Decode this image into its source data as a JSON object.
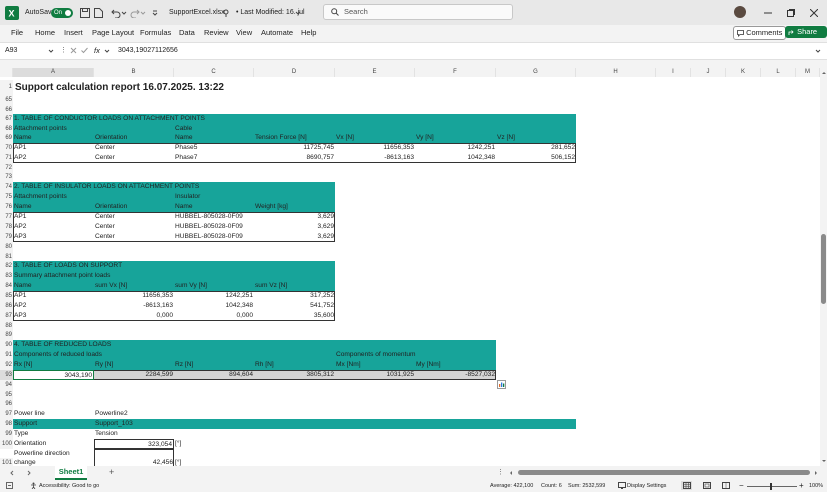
{
  "titlebar": {
    "autosave_label": "AutoSave",
    "autosave_state": "On",
    "filename": "SupportExcel.xlsx",
    "last_modified": "• Last Modified: 16. jul",
    "search_placeholder": "Search"
  },
  "menu": [
    "File",
    "Home",
    "Insert",
    "Page Layout",
    "Formulas",
    "Data",
    "Review",
    "View",
    "Automate",
    "Help"
  ],
  "menu_right": {
    "comments": "Comments",
    "share": "Share"
  },
  "formula": {
    "cell_ref": "A93",
    "fx": "fx",
    "value": "3043,190271126​56"
  },
  "columns": [
    "A",
    "B",
    "C",
    "D",
    "E",
    "F",
    "G",
    "H",
    "I",
    "J",
    "K",
    "L",
    "M"
  ],
  "rows": {
    "r1": "1",
    "r65": "65",
    "r66": "66",
    "r67": "67",
    "r68": "68",
    "r69": "69",
    "r70": "70",
    "r71": "71",
    "r72": "72",
    "r73": "73",
    "r74": "74",
    "r75": "75",
    "r76": "76",
    "r77": "77",
    "r78": "78",
    "r79": "79",
    "r80": "80",
    "r81": "81",
    "r82": "82",
    "r83": "83",
    "r84": "84",
    "r85": "85",
    "r86": "86",
    "r87": "87",
    "r88": "88",
    "r89": "89",
    "r90": "90",
    "r91": "91",
    "r92": "92",
    "r93": "93",
    "r94": "94",
    "r95": "95",
    "r96": "96",
    "r97": "97",
    "r98": "98",
    "r99": "99",
    "r100": "100",
    "r101": "101"
  },
  "report_title": "Support calculation report 16.07.2025. 13:22",
  "t1": {
    "title": "1.   TABLE OF CONDUCTOR LOADS ON ATTACHMENT POINTS",
    "group_a": "Attachment points",
    "group_b": "Cable",
    "headers": [
      "Name",
      "Orientation",
      "Name",
      "Tension Force [N]",
      "Vx [N]",
      "Vy [N]",
      "Vz [N]"
    ],
    "rows": [
      [
        "AP1",
        "Center",
        "Phase5",
        "11725,745",
        "11656,353",
        "1242,251",
        "281,652"
      ],
      [
        "AP2",
        "Center",
        "Phase7",
        "8690,757",
        "-8613,163",
        "1042,348",
        "506,152"
      ]
    ]
  },
  "t2": {
    "title": "2.   TABLE OF INSULATOR LOADS ON ATTACHMENT POINTS",
    "group_a": "Attachment points",
    "group_b": "Insulator",
    "headers": [
      "Name",
      "Orientation",
      "Name",
      "Weight [kg]"
    ],
    "rows": [
      [
        "AP1",
        "Center",
        "HUBBEL-805028-0F09",
        "3,629"
      ],
      [
        "AP2",
        "Center",
        "HUBBEL-805028-0F09",
        "3,629"
      ],
      [
        "AP3",
        "Center",
        "HUBBEL-805028-0F09",
        "3,629"
      ]
    ]
  },
  "t3": {
    "title": "3.   TABLE OF LOADS ON SUPPORT",
    "group_a": "Summary attachment point loads",
    "headers": [
      "Name",
      "sum Vx [N]",
      "sum Vy [N]",
      "sum Vz [N]"
    ],
    "rows": [
      [
        "AP1",
        "11656,353",
        "1242,251",
        "317,252"
      ],
      [
        "AP2",
        "-8613,163",
        "1042,348",
        "541,752"
      ],
      [
        "AP3",
        "0,000",
        "0,000",
        "35,600"
      ]
    ]
  },
  "t4": {
    "title": "4.   TABLE OF REDUCED LOADS",
    "group_a": "Components of reduced loads",
    "group_b": "Components of momentum",
    "headers": [
      "Rx [N]",
      "Ry [N]",
      "Rz [N]",
      "Rh [N]",
      "Mx [Nm]",
      "My [Nm]"
    ],
    "row": [
      "3043,190",
      "2284,599",
      "894,604",
      "3805,312",
      "1031,925",
      "-8527,032"
    ]
  },
  "info": {
    "powerline_label": "Power line",
    "powerline_value": "Powerline2",
    "support_label": "Support",
    "support_value": "Support_103",
    "type_label": "Type",
    "type_value": "Tension",
    "orientation_label": "Orientation",
    "orientation_value": "323,054",
    "orientation_unit": "[°]",
    "pl_dir_label1": "Powerline direction",
    "pl_dir_label2": "change",
    "pl_dir_value": "42,456",
    "pl_dir_unit": "[°]"
  },
  "sheet_tab": "Sheet1",
  "status": {
    "accessibility": "Accessibility: Good to go",
    "average": "Average: 422,100",
    "count": "Count: 6",
    "sum": "Sum: 2532,599",
    "display": "Display Settings",
    "zoom": "100%"
  },
  "colors": {
    "accent": "#17a49a",
    "excel_green": "#107c41"
  }
}
